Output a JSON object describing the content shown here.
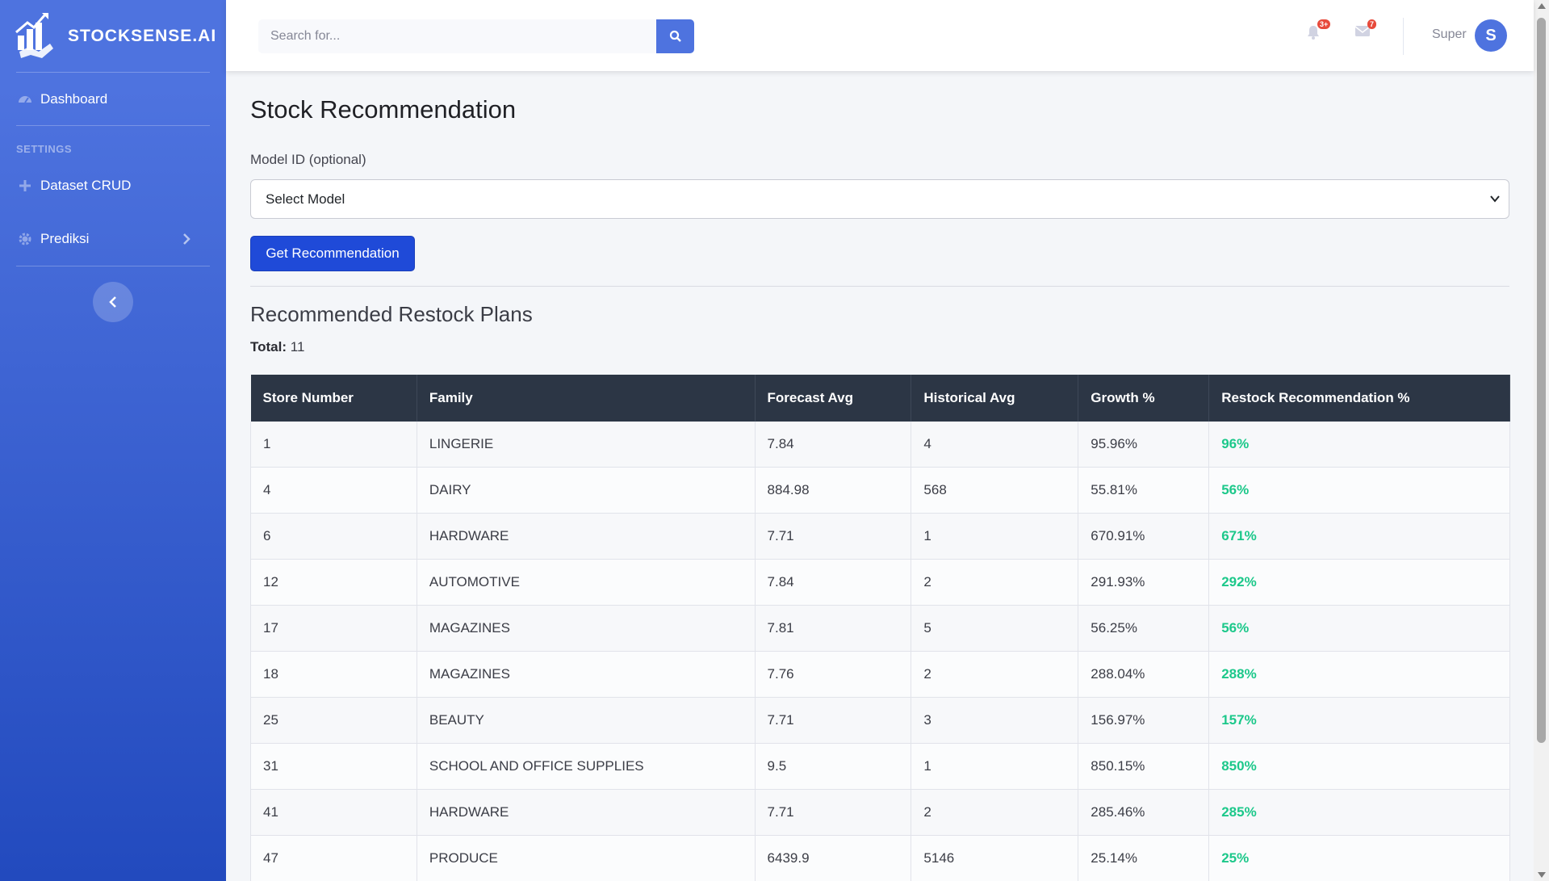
{
  "brand": {
    "name": "STOCKSENSE.AI",
    "logo_icon": "bar-chart-growth-icon"
  },
  "sidebar": {
    "items": [
      {
        "label": "Dashboard",
        "icon": "tachometer-icon"
      }
    ],
    "heading": "SETTINGS",
    "settings_items": [
      {
        "label": "Dataset CRUD",
        "icon": "plus-icon"
      },
      {
        "label": "Prediksi",
        "icon": "gear-icon"
      }
    ]
  },
  "topbar": {
    "search_placeholder": "Search for...",
    "alerts_badge": "3+",
    "messages_badge": "7",
    "username": "Super",
    "avatar_letter": "S"
  },
  "page": {
    "title": "Stock Recommendation",
    "model_label": "Model ID (optional)",
    "model_select_value": "Select Model",
    "button_label": "Get Recommendation",
    "section_title": "Recommended Restock Plans",
    "total_label": "Total:",
    "total_value": "11"
  },
  "table": {
    "headers": [
      "Store Number",
      "Family",
      "Forecast Avg",
      "Historical Avg",
      "Growth %",
      "Restock Recommendation %"
    ],
    "rows": [
      [
        "1",
        "LINGERIE",
        "7.84",
        "4",
        "95.96%",
        "96%"
      ],
      [
        "4",
        "DAIRY",
        "884.98",
        "568",
        "55.81%",
        "56%"
      ],
      [
        "6",
        "HARDWARE",
        "7.71",
        "1",
        "670.91%",
        "671%"
      ],
      [
        "12",
        "AUTOMOTIVE",
        "7.84",
        "2",
        "291.93%",
        "292%"
      ],
      [
        "17",
        "MAGAZINES",
        "7.81",
        "5",
        "56.25%",
        "56%"
      ],
      [
        "18",
        "MAGAZINES",
        "7.76",
        "2",
        "288.04%",
        "288%"
      ],
      [
        "25",
        "BEAUTY",
        "7.71",
        "3",
        "156.97%",
        "157%"
      ],
      [
        "31",
        "SCHOOL AND OFFICE SUPPLIES",
        "9.5",
        "1",
        "850.15%",
        "850%"
      ],
      [
        "41",
        "HARDWARE",
        "7.71",
        "2",
        "285.46%",
        "285%"
      ],
      [
        "47",
        "PRODUCE",
        "6439.9",
        "5146",
        "25.14%",
        "25%"
      ]
    ]
  },
  "colors": {
    "sidebar_top": "#4e73df",
    "sidebar_bottom": "#224abe",
    "primary": "#1f4ad8",
    "table_header": "#2c3645",
    "positive": "#1cc88a"
  }
}
